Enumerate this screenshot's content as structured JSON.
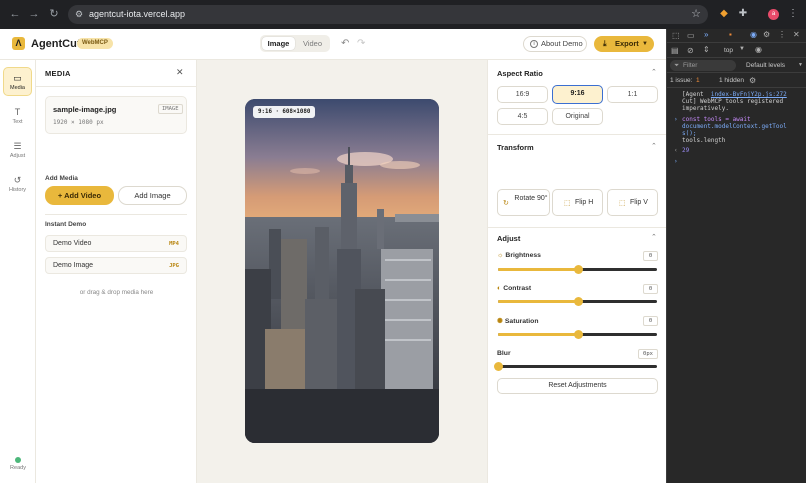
{
  "browser": {
    "url": "agentcut-iota.vercel.app",
    "profile_initial": "a"
  },
  "app": {
    "brand": "AgentCut",
    "badge": "WebMCP",
    "view_toggle": {
      "image": "Image",
      "video": "Video",
      "selected": "Image"
    },
    "about_label": "About Demo",
    "export_label": "Export"
  },
  "rail": {
    "items": [
      {
        "label": "Media",
        "icon": "folder-icon",
        "active": true
      },
      {
        "label": "Text",
        "icon": "text-icon",
        "active": false
      },
      {
        "label": "Adjust",
        "icon": "sliders-icon",
        "active": false
      },
      {
        "label": "History",
        "icon": "history-icon",
        "active": false
      }
    ],
    "status": "Ready",
    "status_color": "#4cb77a"
  },
  "media": {
    "title": "MEDIA",
    "file": {
      "name": "sample-image.jpg",
      "type": "IMAGE",
      "dims": "1920 × 1080 px"
    },
    "add_media_label": "Add Media",
    "add_video": "Add Video",
    "add_image": "Add Image",
    "instant_demo_label": "Instant Demo",
    "demos": [
      {
        "name": "Demo Video",
        "format": "MP4"
      },
      {
        "name": "Demo Image",
        "format": "JPG"
      }
    ],
    "drop_hint": "or drag & drop media here"
  },
  "canvas": {
    "badge": "9:16 · 608×1080"
  },
  "aspect_ratio": {
    "title": "Aspect Ratio",
    "options": [
      "16:9",
      "9:16",
      "1:1",
      "4:5",
      "Original"
    ],
    "selected": "9:16"
  },
  "transform": {
    "title": "Transform",
    "rotate": "Rotate 90°",
    "flip_h": "Flip H",
    "flip_v": "Flip V"
  },
  "adjust": {
    "title": "Adjust",
    "brightness": {
      "label": "Brightness",
      "value": "0",
      "level": 0.5
    },
    "contrast": {
      "label": "Contrast",
      "value": "0",
      "level": 0.5
    },
    "saturation": {
      "label": "Saturation",
      "value": "0",
      "level": 0.5
    },
    "blur": {
      "label": "Blur",
      "value": "0px",
      "level": 0
    },
    "reset": "Reset Adjustments"
  },
  "devtools": {
    "context": "top",
    "filter_placeholder": "Filter",
    "levels": "Default levels",
    "issues": "1 issue:",
    "issue_count": "1",
    "hidden": "1 hidden",
    "log_prefix": "[Agent",
    "log_link": "index-BvFnjY2p.js:272",
    "log_lines": [
      "Cut] WebMCP tools registered",
      "imperatively."
    ],
    "input_lines": [
      "const tools = await",
      "document.modelContext.getTool",
      "s();",
      "tools.length"
    ],
    "result": "29",
    "colors": {
      "accent": "#e9b83c",
      "selected_border": "#3b6fd1"
    }
  }
}
